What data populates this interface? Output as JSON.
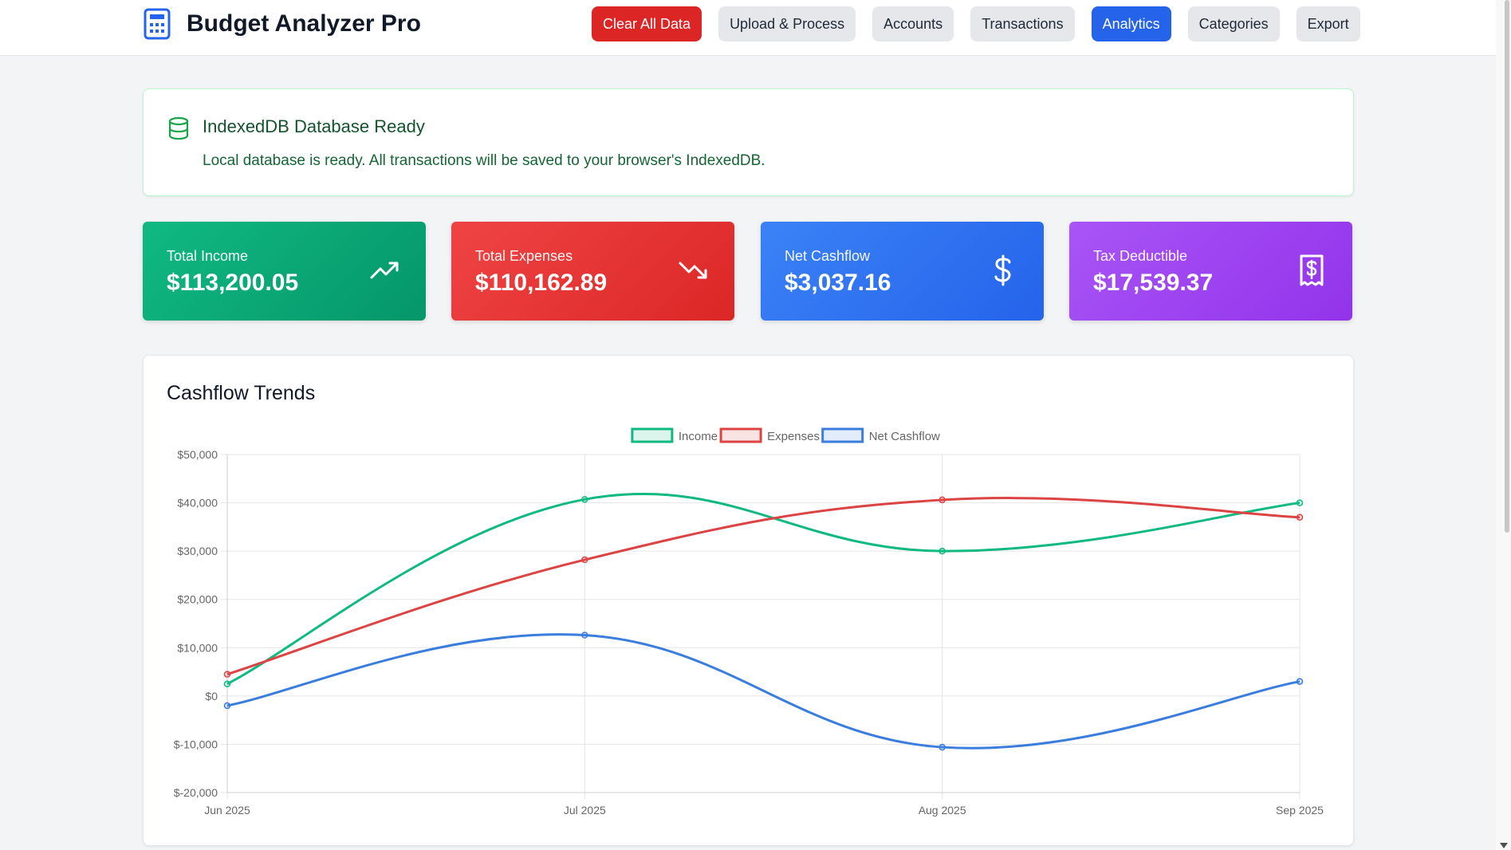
{
  "app": {
    "title": "Budget Analyzer Pro",
    "icon": "calculator-icon"
  },
  "nav": {
    "items": [
      {
        "label": "Clear All Data",
        "style": "danger"
      },
      {
        "label": "Upload & Process",
        "style": "default"
      },
      {
        "label": "Accounts",
        "style": "default"
      },
      {
        "label": "Transactions",
        "style": "default"
      },
      {
        "label": "Analytics",
        "style": "active"
      },
      {
        "label": "Categories",
        "style": "default"
      },
      {
        "label": "Export",
        "style": "default"
      }
    ]
  },
  "banner": {
    "icon": "database-icon",
    "title": "IndexedDB Database Ready",
    "message": "Local database is ready. All transactions will be saved to your browser's IndexedDB."
  },
  "stats": {
    "income": {
      "label": "Total Income",
      "value": "$113,200.05",
      "icon": "trending-up-icon"
    },
    "expenses": {
      "label": "Total Expenses",
      "value": "$110,162.89",
      "icon": "trending-down-icon"
    },
    "net": {
      "label": "Net Cashflow",
      "value": "$3,037.16",
      "icon": "dollar-icon"
    },
    "tax": {
      "label": "Tax Deductible",
      "value": "$17,539.37",
      "icon": "receipt-icon"
    }
  },
  "colors": {
    "income": "#10b981",
    "expenses": "#dc4444",
    "net": "#3b7ddd",
    "danger": "#dc2626",
    "active": "#2563eb"
  },
  "chart_data": {
    "type": "line",
    "title": "Cashflow Trends",
    "categories": [
      "Jun 2025",
      "Jul 2025",
      "Aug 2025",
      "Sep 2025"
    ],
    "series": [
      {
        "name": "Income",
        "values": [
          2500,
          40700,
          30000,
          40000
        ]
      },
      {
        "name": "Expenses",
        "values": [
          4500,
          28200,
          40600,
          37000
        ]
      },
      {
        "name": "Net Cashflow",
        "values": [
          -2000,
          12600,
          -10600,
          3000
        ]
      }
    ],
    "ylim": [
      -20000,
      50000
    ],
    "yticks": [
      50000,
      40000,
      30000,
      20000,
      10000,
      0,
      -10000,
      -20000
    ],
    "ytick_labels": [
      "$50,000",
      "$40,000",
      "$30,000",
      "$20,000",
      "$10,000",
      "$0",
      "$-10,000",
      "$-20,000"
    ],
    "legend_position": "top-center",
    "grid": true,
    "smooth": true
  }
}
